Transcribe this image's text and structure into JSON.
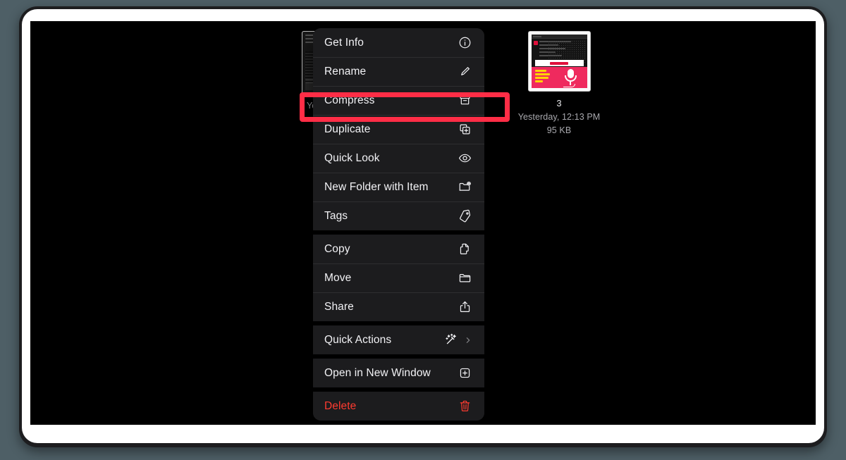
{
  "window": {
    "app": "Finder",
    "background_color": "#4e5f66",
    "screen_background": "#000000"
  },
  "files": [
    {
      "name": "",
      "date": "Yesterday",
      "size": "",
      "thumbnail": "document-preview-thumbnail",
      "occluded": true
    },
    {
      "name": "3",
      "date": "Yesterday, 12:13 PM",
      "size": "95 KB",
      "thumbnail": "email-newsletter-thumbnail",
      "occluded": false
    }
  ],
  "context_menu": {
    "highlighted_item": "Compress",
    "groups": [
      {
        "items": [
          {
            "label": "Get Info",
            "icon": "info-circle-icon",
            "destructive": false,
            "submenu": false
          },
          {
            "label": "Rename",
            "icon": "pencil-icon",
            "destructive": false,
            "submenu": false
          },
          {
            "label": "Compress",
            "icon": "archive-box-icon",
            "destructive": false,
            "submenu": false
          },
          {
            "label": "Duplicate",
            "icon": "duplicate-icon",
            "destructive": false,
            "submenu": false
          },
          {
            "label": "Quick Look",
            "icon": "eye-icon",
            "destructive": false,
            "submenu": false
          },
          {
            "label": "New Folder with Item",
            "icon": "folder-plus-icon",
            "destructive": false,
            "submenu": false
          },
          {
            "label": "Tags",
            "icon": "tag-icon",
            "destructive": false,
            "submenu": false
          }
        ]
      },
      {
        "items": [
          {
            "label": "Copy",
            "icon": "copy-icon",
            "destructive": false,
            "submenu": false
          },
          {
            "label": "Move",
            "icon": "folder-icon",
            "destructive": false,
            "submenu": false
          },
          {
            "label": "Share",
            "icon": "share-icon",
            "destructive": false,
            "submenu": false
          }
        ]
      },
      {
        "items": [
          {
            "label": "Quick Actions",
            "icon": "magic-wand-icon",
            "destructive": false,
            "submenu": true
          }
        ]
      },
      {
        "items": [
          {
            "label": "Open in New Window",
            "icon": "plus-square-icon",
            "destructive": false,
            "submenu": false
          }
        ]
      },
      {
        "items": [
          {
            "label": "Delete",
            "icon": "trash-icon",
            "destructive": true,
            "submenu": false
          }
        ]
      }
    ]
  },
  "annotation": {
    "type": "highlight-rectangle",
    "color": "#ff2d46",
    "targets": "Compress"
  }
}
